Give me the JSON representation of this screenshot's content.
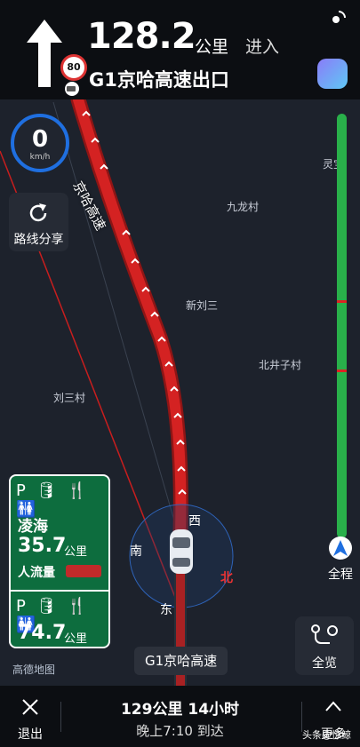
{
  "nav": {
    "distance": "128.2",
    "distance_unit": "公里",
    "action": "进入",
    "road_name": "G1京哈高速出口",
    "speed_limit": "80"
  },
  "speedometer": {
    "value": "0",
    "unit": "km/h"
  },
  "share": {
    "label": "路线分享"
  },
  "places": [
    {
      "name": "灵宝"
    },
    {
      "name": "九龙村"
    },
    {
      "name": "新刘三"
    },
    {
      "name": "北井子村"
    },
    {
      "name": "刘三村"
    }
  ],
  "route_label": "京哈高速",
  "compass": {
    "west": "西",
    "south": "南",
    "east": "东",
    "north": "北"
  },
  "service_area": {
    "name": "凌海",
    "distance": "35.7",
    "unit": "公里",
    "crowd_label": "人流量",
    "next_distance": "74.7",
    "next_unit": "公里",
    "facilities": "P 🛢 🍴 🚻"
  },
  "progress": {
    "overview_label": "全程",
    "route_color": "#29b04a",
    "congestion_color": "#d22"
  },
  "overview_button": {
    "label": "全览"
  },
  "current_road": "G1京哈高速",
  "map_logo": "高德地图",
  "bottom": {
    "exit_label": "退出",
    "remaining": "129公里  14小时",
    "arrival": "晚上7:10 到达",
    "more_label": "更多"
  },
  "watermark": "头条@惊鲸",
  "colors": {
    "route": "#c81e1e",
    "accent": "#1f6fe0",
    "card": "#0d6d3e"
  }
}
